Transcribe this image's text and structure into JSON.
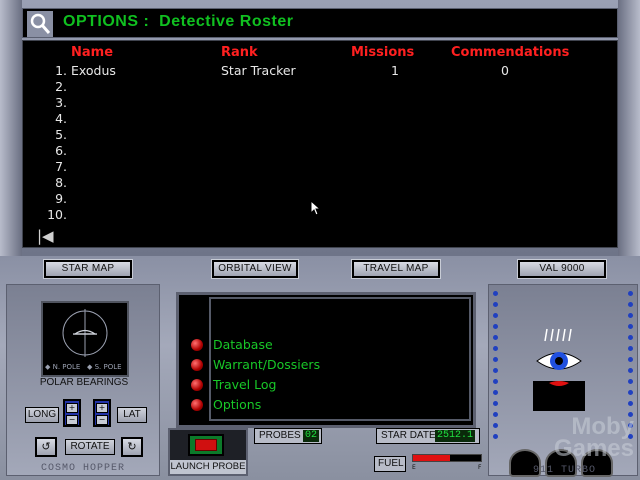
{
  "title": "OPTIONS :  Detective Roster",
  "columns": {
    "name": "Name",
    "rank": "Rank",
    "missions": "Missions",
    "commendations": "Commendations"
  },
  "roster": [
    {
      "num": "1.",
      "name": "Exodus",
      "rank": "Star Tracker",
      "missions": "1",
      "commendations": "0"
    },
    {
      "num": "2.",
      "name": "",
      "rank": "",
      "missions": "",
      "commendations": ""
    },
    {
      "num": "3.",
      "name": "",
      "rank": "",
      "missions": "",
      "commendations": ""
    },
    {
      "num": "4.",
      "name": "",
      "rank": "",
      "missions": "",
      "commendations": ""
    },
    {
      "num": "5.",
      "name": "",
      "rank": "",
      "missions": "",
      "commendations": ""
    },
    {
      "num": "6.",
      "name": "",
      "rank": "",
      "missions": "",
      "commendations": ""
    },
    {
      "num": "7.",
      "name": "",
      "rank": "",
      "missions": "",
      "commendations": ""
    },
    {
      "num": "8.",
      "name": "",
      "rank": "",
      "missions": "",
      "commendations": ""
    },
    {
      "num": "9.",
      "name": "",
      "rank": "",
      "missions": "",
      "commendations": ""
    },
    {
      "num": "10.",
      "name": "",
      "rank": "",
      "missions": "",
      "commendations": ""
    }
  ],
  "buttons": {
    "star_map": "STAR MAP",
    "orbital_view": "ORBITAL VIEW",
    "travel_map": "TRAVEL MAP",
    "val": "VAL 9000"
  },
  "left_panel": {
    "polar_label": "POLAR BEARINGS",
    "n_pole": "N. POLE",
    "s_pole": "S. POLE",
    "long": "LONG",
    "lat": "LAT",
    "rotate": "ROTATE",
    "brand": "COSMO HOPPER"
  },
  "menu": [
    "Database",
    "Warrant/Dossiers",
    "Travel Log",
    "Options"
  ],
  "launch": "LAUNCH PROBE",
  "probes": {
    "label": "PROBES",
    "value": "02"
  },
  "star_date": {
    "label": "STAR DATE",
    "value": "2512.1"
  },
  "fuel": {
    "label": "FUEL",
    "level": 0.55,
    "empty": "E",
    "full": "F"
  },
  "right_panel": {
    "brand": "911 TURBO"
  },
  "watermark": "Moby Games",
  "colors": {
    "title_green": "#10c020",
    "header_red": "#ff2020",
    "menu_green": "#18c828",
    "led_red": "#d01010"
  }
}
